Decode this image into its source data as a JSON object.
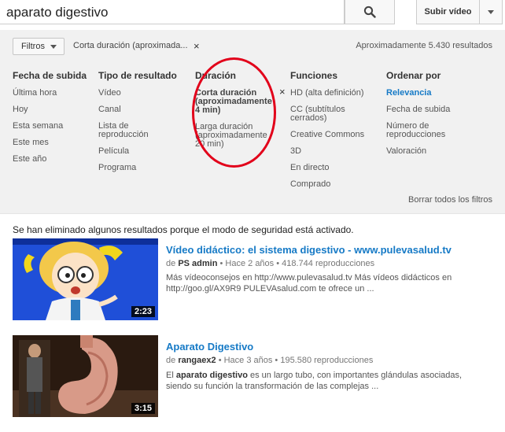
{
  "search": {
    "query": "aparato digestivo",
    "search_icon": "search-icon"
  },
  "header": {
    "upload_label": "Subir vídeo",
    "menu_icon": "caret-down-icon"
  },
  "filters": {
    "button_label": "Filtros",
    "active_filter": "Corta duración (aproximada...",
    "active_close": "×",
    "result_count": "Aproximadamente 5.430 resultados",
    "clear_all": "Borrar todos los filtros",
    "remove_x": "×",
    "columns": [
      {
        "title": "Fecha de subida",
        "items": [
          "Última hora",
          "Hoy",
          "Esta semana",
          "Este mes",
          "Este año"
        ]
      },
      {
        "title": "Tipo de resultado",
        "items": [
          "Vídeo",
          "Canal",
          "Lista de reproducción",
          "Película",
          "Programa"
        ]
      },
      {
        "title": "Duración",
        "items": [
          "Corta duración (aproximadamente 4 min)",
          "Larga duración (aproximadamente 20 min)"
        ]
      },
      {
        "title": "Funciones",
        "items": [
          "HD (alta definición)",
          "CC (subtítulos cerrados)",
          "Creative Commons",
          "3D",
          "En directo",
          "Comprado"
        ]
      },
      {
        "title": "Ordenar por",
        "items": [
          "Relevancia",
          "Fecha de subida",
          "Número de reproducciones",
          "Valoración"
        ]
      }
    ]
  },
  "safety_notice": "Se han eliminado algunos resultados porque el modo de seguridad está activado.",
  "results": [
    {
      "title": "Vídeo didáctico: el sistema digestivo - www.pulevasalud.tv",
      "by": "de",
      "channel": "PS admin",
      "age": "• Hace 2 años •",
      "views": "418.744 reproducciones",
      "desc_line1": "Más vídeoconsejos en http://www.pulevasalud.tv Más vídeos didácticos en",
      "desc_line2": "http://goo.gl/AX9R9 PULEVAsalud.com te ofrece un ...",
      "duration": "2:23"
    },
    {
      "title": "Aparato Digestivo",
      "by": "de",
      "channel": "rangaex2",
      "age": "• Hace 3 años •",
      "views": "195.580 reproducciones",
      "desc_pre": "El",
      "desc_hl": "aparato digestivo",
      "desc_post": "es un largo tubo, con importantes glándulas asociadas, siendo su función la transformación de las complejas ...",
      "duration": "3:15"
    }
  ],
  "colors": {
    "link_blue": "#167ac6",
    "highlight_red": "#e2001a",
    "panel_bg": "#f1f1f1"
  }
}
